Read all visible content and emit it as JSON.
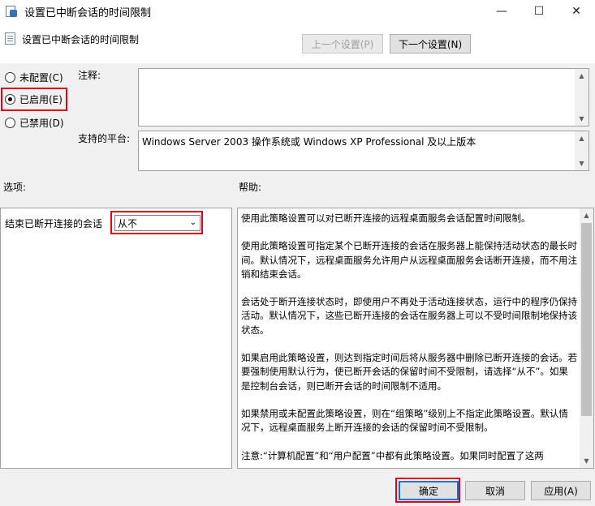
{
  "window": {
    "title": "设置已中断会话的时间限制",
    "minimize": "—",
    "maximize": "☐",
    "close": "✕"
  },
  "header": {
    "title": "设置已中断会话的时间限制",
    "prev_button": "上一个设置(P)",
    "next_button": "下一个设置(N)"
  },
  "state": {
    "not_configured": "未配置(C)",
    "enabled": "已启用(E)",
    "disabled": "已禁用(D)"
  },
  "comment_label": "注释:",
  "platform_label": "支持的平台:",
  "platform_text": "Windows Server 2003 操作系统或 Windows XP Professional 及以上版本",
  "options_label": "选项:",
  "help_label": "帮助:",
  "option": {
    "label": "结束已断开连接的会话",
    "value": "从不"
  },
  "help": {
    "paragraphs": [
      "使用此策略设置可以对已断开连接的远程桌面服务会话配置时间限制。",
      "使用此策略设置可指定某个已断开连接的会话在服务器上能保持活动状态的最长时间。默认情况下，远程桌面服务允许用户从远程桌面服务会话断开连接，而不用注销和结束会话。",
      "会话处于断开连接状态时，即使用户不再处于活动连接状态，运行中的程序仍保持活动。默认情况下，这些已断开连接的会话在服务器上可以不受时间限制地保持该状态。",
      "如果启用此策略设置，则达到指定时间后将从服务器中删除已断开连接的会话。若要强制使用默认行为，使已断开会话的保留时间不受限制，请选择“从不”。如果是控制台会话，则已断开会话的时间限制不适用。",
      "如果禁用或未配置此策略设置，则在“组策略”级别上不指定此策略设置。默认情况下，远程桌面服务上断开连接的会话的保留时间不受限制。",
      "注意:“计算机配置”和“用户配置”中都有此策略设置。如果同时配置了这两"
    ]
  },
  "buttons": {
    "ok": "确定",
    "cancel": "取消",
    "apply": "应用(A)"
  },
  "colors": {
    "highlight_box": "#e0001a",
    "focus_border": "#0078d7"
  }
}
